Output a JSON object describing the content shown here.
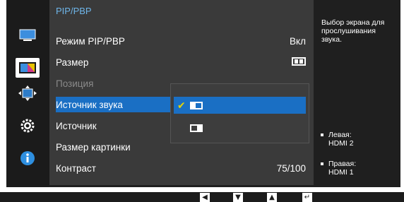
{
  "menu": {
    "title": "PIP/PBP",
    "items": [
      {
        "label": "Режим PIP/PBP",
        "value": "Вкл"
      },
      {
        "label": "Размер",
        "value": ""
      },
      {
        "label": "Позиция",
        "value": ""
      },
      {
        "label": "Источник звука",
        "value": ""
      },
      {
        "label": "Источник",
        "value": ""
      },
      {
        "label": "Размер картинки",
        "value": ""
      },
      {
        "label": "Контраст",
        "value": "75/100"
      }
    ]
  },
  "submenu": {
    "options": [
      "left-source",
      "right-source"
    ],
    "selected_index": 0
  },
  "info": {
    "description": "Выбор экрана для прослушивания звука.",
    "left_label": "Левая:",
    "left_value": "HDMI 2",
    "right_label": "Правая:",
    "right_value": "HDMI 1"
  },
  "icons": [
    "picture-icon",
    "color-icon",
    "size-position-icon",
    "settings-gear-icon",
    "info-icon"
  ],
  "colors": {
    "accent": "#1a6fc4",
    "title": "#6fb6ea",
    "check": "#e8d400"
  }
}
